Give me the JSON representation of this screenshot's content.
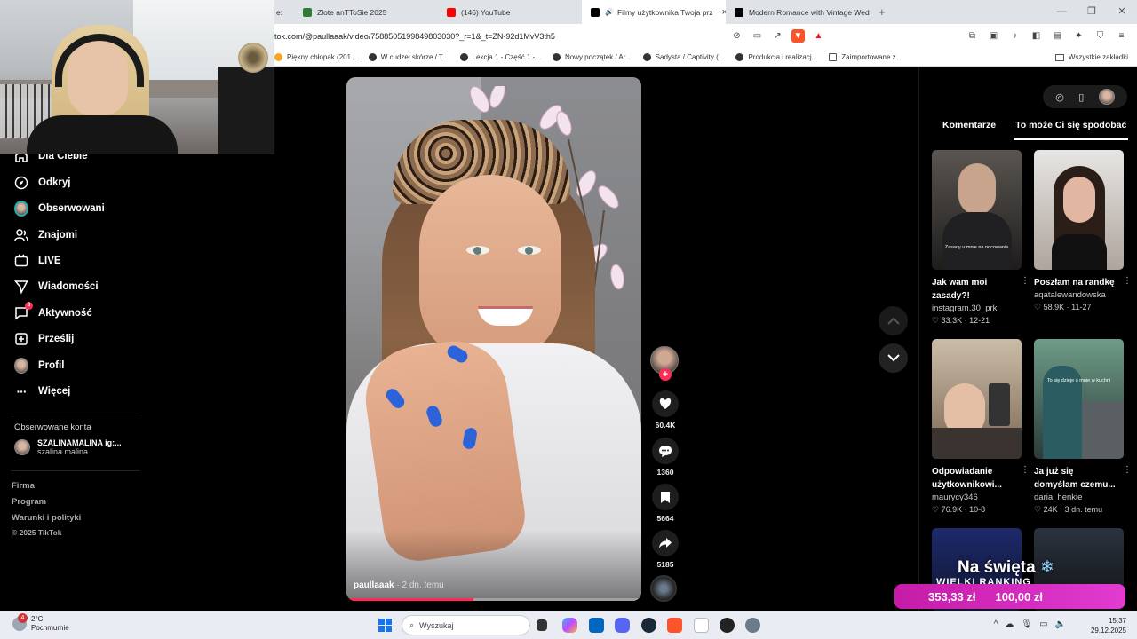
{
  "browser": {
    "tabs": [
      {
        "label": "e:",
        "icon_color": "#888888",
        "active": false
      },
      {
        "label": "Złote anTToSie 2025",
        "icon_color": "#2e7d32",
        "active": false
      },
      {
        "label": "(146) YouTube",
        "icon_color": "#ff0000",
        "active": false
      },
      {
        "label": "Filmy użytkownika Twoja prz",
        "icon_color": "#000000",
        "active": true
      },
      {
        "label": "Modern Romance with Vintage Wed",
        "icon_color": "#000000",
        "active": false
      }
    ],
    "new_tab": "+",
    "url": "tok.com/@paullaaak/video/7588505199849803030?_r=1&_t=ZN-92d1MvV3th5",
    "bookmarks": [
      {
        "label": "Piękny chłopak (201..."
      },
      {
        "label": "W cudzej skórze / T..."
      },
      {
        "label": "Lekcja 1 - Część 1 -..."
      },
      {
        "label": "Nowy początek / Ar..."
      },
      {
        "label": "Sadysta / Captivity (..."
      },
      {
        "label": "Produkcja i realizacj..."
      },
      {
        "label": "Zaimportowane z..."
      }
    ],
    "all_bookmarks": "Wszystkie zakładki"
  },
  "sidebar": {
    "items": [
      {
        "label": "Dla Ciebie",
        "icon": "home-icon"
      },
      {
        "label": "Odkryj",
        "icon": "compass-icon"
      },
      {
        "label": "Obserwowani",
        "icon": "avatar-icon"
      },
      {
        "label": "Znajomi",
        "icon": "friends-icon"
      },
      {
        "label": "LIVE",
        "icon": "live-icon"
      },
      {
        "label": "Wiadomości",
        "icon": "send-icon"
      },
      {
        "label": "Aktywność",
        "icon": "activity-icon",
        "badge": "8"
      },
      {
        "label": "Prześlij",
        "icon": "upload-icon"
      },
      {
        "label": "Profil",
        "icon": "profile-icon"
      },
      {
        "label": "Więcej",
        "icon": "more-icon"
      }
    ],
    "followed_title": "Obserwowane konta",
    "followed": {
      "name": "SZALINAMALINA ig:...",
      "handle": "szalina.malina"
    },
    "footer": [
      "Firma",
      "Program",
      "Warunki i polityki",
      "© 2025 TikTok"
    ]
  },
  "video": {
    "author": "paullaaak",
    "time": "· 2 dn. temu",
    "progress": 0.43
  },
  "actions": {
    "likes": "60.4K",
    "comments": "1360",
    "saves": "5664",
    "shares": "5185"
  },
  "right_panel": {
    "tabs": [
      "Komentarze",
      "To może Ci się spodobać"
    ],
    "cards": [
      {
        "title1": "Jak wam moi",
        "title2": "zasady?!",
        "user": "instagram.30_prk",
        "likes": "33.3K",
        "date": "12-21",
        "caption": "Zasady u mnie na nocowanie",
        "c1": "#3d3a37",
        "c2": "#1e1d1c"
      },
      {
        "title1": "Poszłam na randkę",
        "title2": "",
        "user": "aqatalewandowska",
        "likes": "58.9K",
        "date": "11-27",
        "caption": "",
        "c1": "#d8d6d4",
        "c2": "#a9a19a"
      },
      {
        "title1": "Odpowiadanie",
        "title2": "użytkownikowi...",
        "user": "maurycy346",
        "likes": "76.9K",
        "date": "10-8",
        "caption": "",
        "c1": "#b9a58d",
        "c2": "#5a4a3a"
      },
      {
        "title1": "Ja już się",
        "title2": "domyślam czemu...",
        "user": "daria_henkie",
        "likes": "24K",
        "date": "3 dn. temu",
        "caption": "To się dzieje u mnie w kuchni",
        "c1": "#4d6a63",
        "c2": "#2a3b3a"
      }
    ]
  },
  "promo": {
    "title": "Na święta",
    "subtitle": "WIELKI RANKING",
    "amount1": "353,33 zł",
    "amount2": "100,00 zł"
  },
  "taskbar": {
    "temp": "2°C",
    "weather": "Pochmurnie",
    "weather_badge": "4",
    "search": "Wyszukaj",
    "time": "15:37",
    "date": "29.12.2025"
  }
}
